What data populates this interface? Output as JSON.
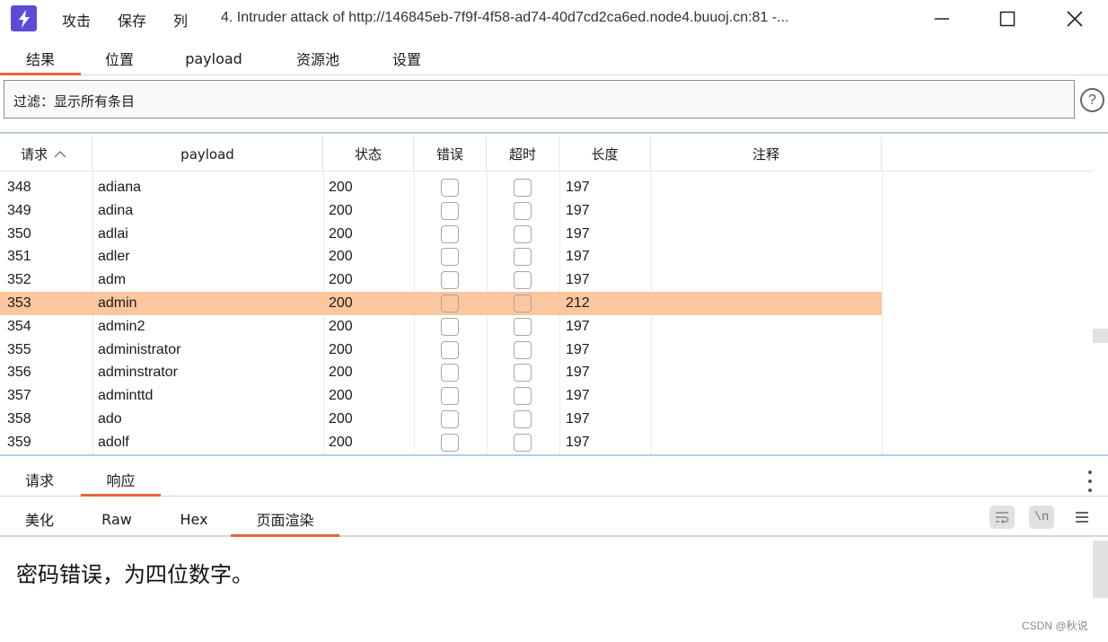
{
  "titlebar": {
    "menu": [
      "攻击",
      "保存",
      "列"
    ],
    "title": "4. Intruder attack of http://146845eb-7f9f-4f58-ad74-40d7cd2ca6ed.node4.buuoj.cn:81 -...",
    "icon": "lightning-bolt-icon"
  },
  "top_tabs": [
    "结果",
    "位置",
    "payload",
    "资源池",
    "设置"
  ],
  "filter": {
    "text": "过滤：显示所有条目",
    "help": "?"
  },
  "table": {
    "columns": [
      "请求",
      "payload",
      "状态",
      "错误",
      "超时",
      "长度",
      "注释"
    ],
    "sort_indicator": "^",
    "rows": [
      {
        "req": "348",
        "payload": "adiana",
        "status": "200",
        "length": "197"
      },
      {
        "req": "349",
        "payload": "adina",
        "status": "200",
        "length": "197"
      },
      {
        "req": "350",
        "payload": "adlai",
        "status": "200",
        "length": "197"
      },
      {
        "req": "351",
        "payload": "adler",
        "status": "200",
        "length": "197"
      },
      {
        "req": "352",
        "payload": "adm",
        "status": "200",
        "length": "197"
      },
      {
        "req": "353",
        "payload": "admin",
        "status": "200",
        "length": "212"
      },
      {
        "req": "354",
        "payload": "admin2",
        "status": "200",
        "length": "197"
      },
      {
        "req": "355",
        "payload": "administrator",
        "status": "200",
        "length": "197"
      },
      {
        "req": "356",
        "payload": "adminstrator",
        "status": "200",
        "length": "197"
      },
      {
        "req": "357",
        "payload": "adminttd",
        "status": "200",
        "length": "197"
      },
      {
        "req": "358",
        "payload": "ado",
        "status": "200",
        "length": "197"
      },
      {
        "req": "359",
        "payload": "adolf",
        "status": "200",
        "length": "197"
      }
    ],
    "selected_index": 5,
    "selected_color": "#fcc69e"
  },
  "lower_tabs": [
    "请求",
    "响应"
  ],
  "view_tabs": [
    "美化",
    "Raw",
    "Hex",
    "页面渲染"
  ],
  "tools": {
    "wrap": "word-wrap-icon",
    "newline": "\\n"
  },
  "response": {
    "text": "密码错误，为四位数字。"
  },
  "watermark": "CSDN @秋说",
  "accent": "#e8643a"
}
